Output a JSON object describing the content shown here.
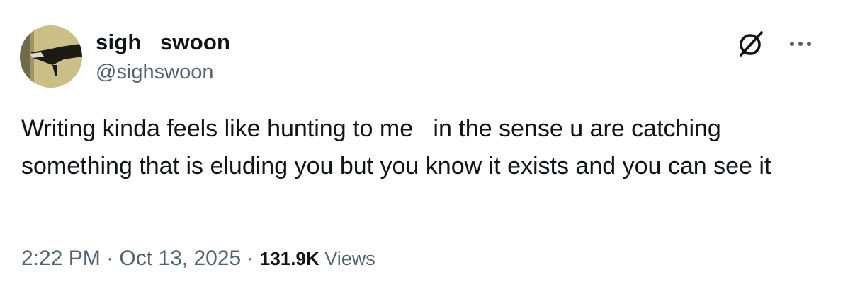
{
  "author": {
    "display_name": "sigh   swoon",
    "handle": "@sighswoon"
  },
  "tweet": {
    "text": "Writing kinda feels like hunting to me   in the sense u are catching something that is eluding you but you know it exists and you can see it"
  },
  "meta": {
    "time": "2:22 PM",
    "date": "Oct 13, 2025",
    "separator": " · ",
    "views_count": "131.9K",
    "views_label": " Views"
  },
  "icons": {
    "grok": "grok-icon",
    "more": "more-options-icon"
  },
  "colors": {
    "text_primary": "#0f1419",
    "text_secondary": "#536471",
    "background": "#ffffff"
  }
}
